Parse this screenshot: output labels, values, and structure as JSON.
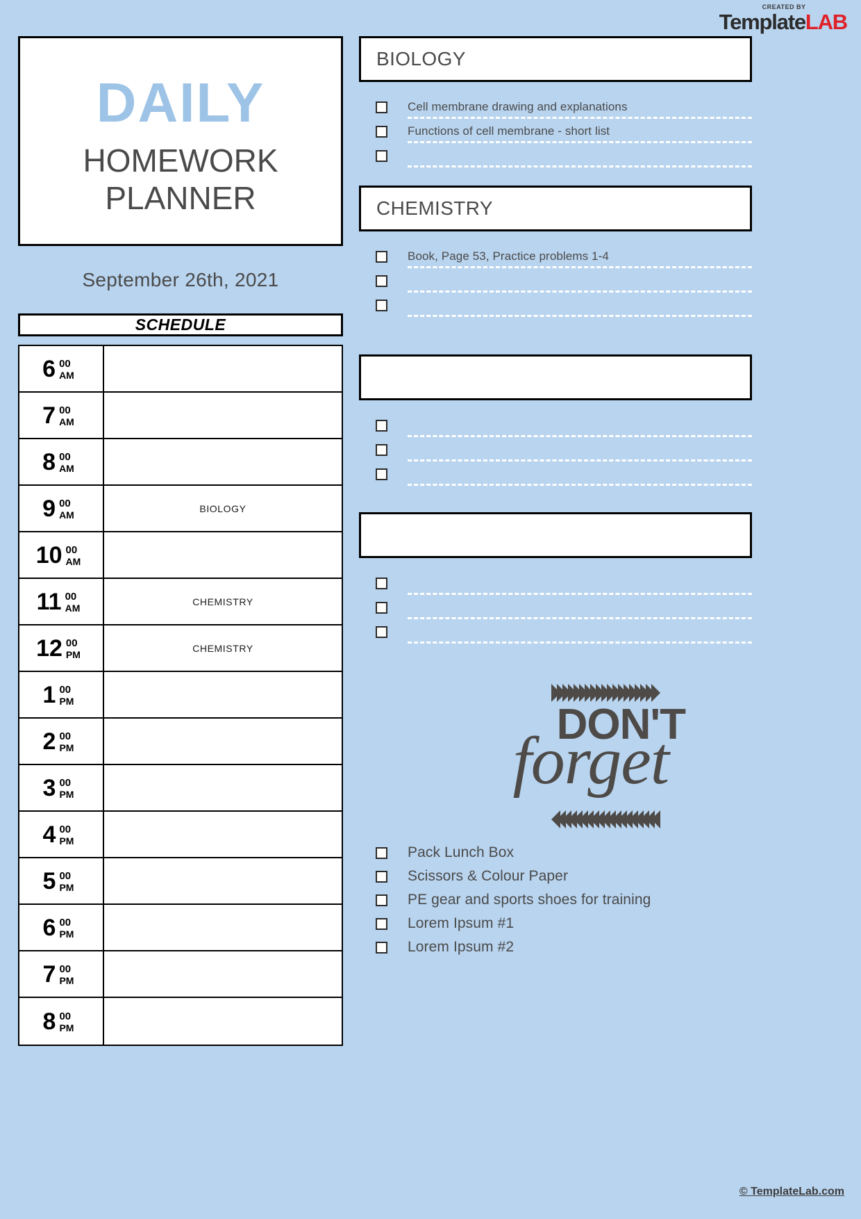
{
  "logo": {
    "created_by": "CREATED BY",
    "brand_dark": "Template",
    "brand_red": "LAB",
    "accent_red": "#e02128"
  },
  "header": {
    "title_accent": "DAILY",
    "title_line1": "HOMEWORK",
    "title_line2": "PLANNER",
    "accent_blue": "#9dc3e6",
    "date": "September 26th, 2021"
  },
  "schedule": {
    "heading": "SCHEDULE",
    "rows": [
      {
        "hour": "6",
        "minutes": "00",
        "meridiem": "AM",
        "entry": ""
      },
      {
        "hour": "7",
        "minutes": "00",
        "meridiem": "AM",
        "entry": ""
      },
      {
        "hour": "8",
        "minutes": "00",
        "meridiem": "AM",
        "entry": ""
      },
      {
        "hour": "9",
        "minutes": "00",
        "meridiem": "AM",
        "entry": "BIOLOGY"
      },
      {
        "hour": "10",
        "minutes": "00",
        "meridiem": "AM",
        "entry": ""
      },
      {
        "hour": "11",
        "minutes": "00",
        "meridiem": "AM",
        "entry": "CHEMISTRY"
      },
      {
        "hour": "12",
        "minutes": "00",
        "meridiem": "PM",
        "entry": "CHEMISTRY"
      },
      {
        "hour": "1",
        "minutes": "00",
        "meridiem": "PM",
        "entry": ""
      },
      {
        "hour": "2",
        "minutes": "00",
        "meridiem": "PM",
        "entry": ""
      },
      {
        "hour": "3",
        "minutes": "00",
        "meridiem": "PM",
        "entry": ""
      },
      {
        "hour": "4",
        "minutes": "00",
        "meridiem": "PM",
        "entry": ""
      },
      {
        "hour": "5",
        "minutes": "00",
        "meridiem": "PM",
        "entry": ""
      },
      {
        "hour": "6",
        "minutes": "00",
        "meridiem": "PM",
        "entry": ""
      },
      {
        "hour": "7",
        "minutes": "00",
        "meridiem": "PM",
        "entry": ""
      },
      {
        "hour": "8",
        "minutes": "00",
        "meridiem": "PM",
        "entry": ""
      }
    ]
  },
  "subjects": [
    {
      "name": "BIOLOGY",
      "tasks": [
        "Cell membrane drawing and explanations",
        "Functions of cell membrane - short list",
        ""
      ]
    },
    {
      "name": "CHEMISTRY",
      "tasks": [
        "Book, Page 53, Practice problems 1-4",
        "",
        ""
      ]
    },
    {
      "name": "",
      "tasks": [
        "",
        "",
        ""
      ]
    },
    {
      "name": "",
      "tasks": [
        "",
        "",
        ""
      ]
    }
  ],
  "forget": {
    "line1": "DON'T",
    "line2": "forget",
    "chevron_top_icon": "chevron-right-icon",
    "chevron_bottom_icon": "chevron-left-icon",
    "chevron_count": 19,
    "color": "#4d4a47"
  },
  "reminders": [
    "Pack Lunch Box",
    "Scissors & Colour Paper",
    "PE gear and sports shoes for training",
    "Lorem Ipsum #1",
    "Lorem Ipsum #2"
  ],
  "footer": {
    "copyright": "© TemplateLab.com"
  }
}
